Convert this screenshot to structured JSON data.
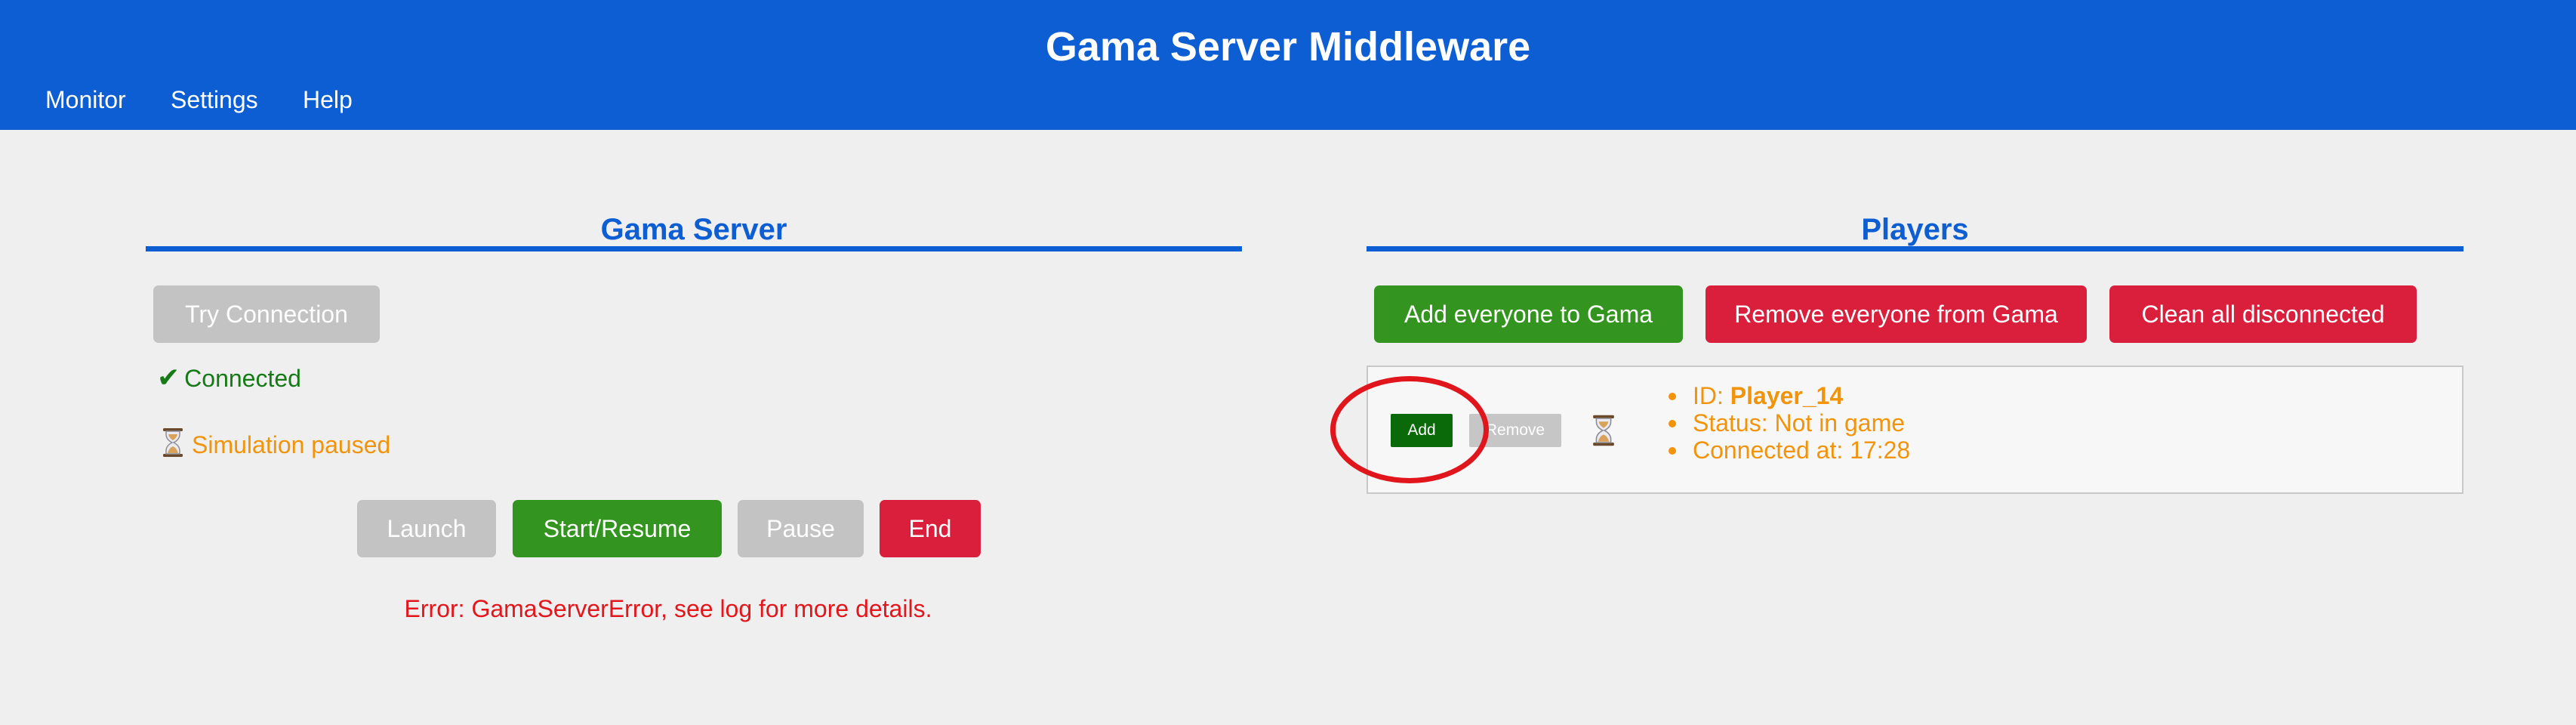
{
  "header": {
    "title": "Gama Server Middleware",
    "nav": [
      "Monitor",
      "Settings",
      "Help"
    ]
  },
  "gama_server": {
    "title": "Gama Server",
    "try_connection_label": "Try Connection",
    "connection_status": "Connected",
    "simulation_status": "Simulation paused",
    "buttons": {
      "launch": "Launch",
      "start_resume": "Start/Resume",
      "pause": "Pause",
      "end": "End"
    },
    "error": "Error: GamaServerError, see log for more details."
  },
  "players": {
    "title": "Players",
    "buttons": {
      "add_everyone": "Add everyone to Gama",
      "remove_everyone": "Remove everyone from Gama",
      "clean_disconnected": "Clean all disconnected"
    },
    "list": [
      {
        "add_label": "Add",
        "remove_label": "Remove",
        "id_label": "ID: ",
        "id": "Player_14",
        "status": "Status: Not in game",
        "connected_at": "Connected at: 17:28"
      }
    ]
  },
  "icons": {
    "check": "check-icon",
    "hourglass": "hourglass-icon"
  },
  "colors": {
    "primary": "#0d5dd3",
    "success": "#33951f",
    "danger": "#d91f3b",
    "disabled": "#c3c3c3",
    "warning": "#f1940c",
    "connected": "#167a16",
    "error": "#e3161c",
    "annotation": "#e0161c"
  }
}
